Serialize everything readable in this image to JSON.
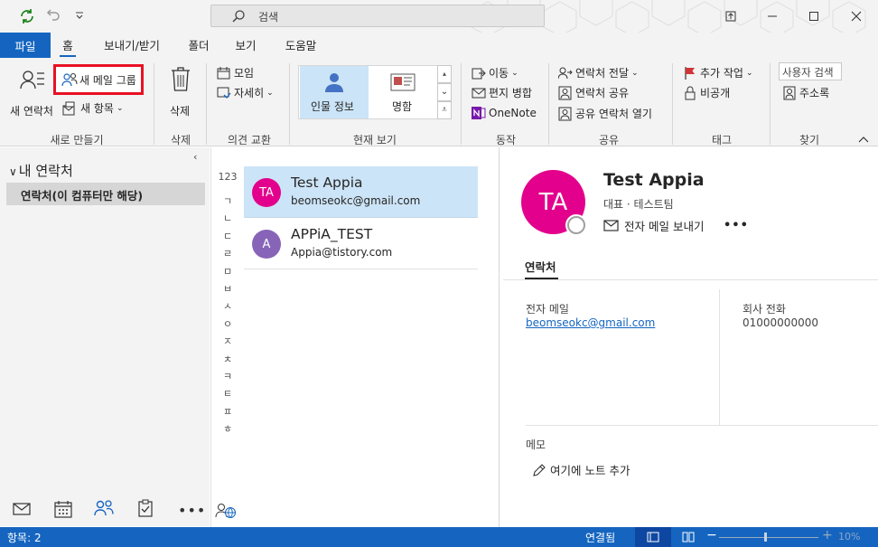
{
  "titlebar": {
    "search_placeholder": "검색",
    "icons": [
      "sync-icon",
      "undo-icon",
      "quick-access-dropdown-icon",
      "search-icon",
      "ribbon-display-options-icon",
      "minimize-icon",
      "maximize-icon",
      "close-icon"
    ]
  },
  "tabs": {
    "file": "파일",
    "home": "홈",
    "send_receive": "보내기/받기",
    "folder": "폴더",
    "view": "보기",
    "help": "도움말"
  },
  "ribbon": {
    "new": {
      "new_contact": "새 연락처",
      "new_contact_group": "새 메일 그룹",
      "new_items": "새 항목",
      "label": "새로 만들기"
    },
    "delete": {
      "button": "삭제",
      "label": "삭제"
    },
    "communicate": {
      "meeting": "모임",
      "more": "자세히",
      "label": "의견 교환"
    },
    "current_view": {
      "people": "인물 정보",
      "business_card": "명함",
      "label": "현재 보기"
    },
    "actions": {
      "move": "이동",
      "mail_merge": "편지 병합",
      "onenote": "OneNote",
      "label": "동작"
    },
    "share": {
      "forward_contact": "연락처 전달",
      "share_contacts": "연락처 공유",
      "open_shared": "공유 연락처 열기",
      "label": "공유"
    },
    "tags": {
      "follow_up": "추가 작업",
      "private": "비공개",
      "label": "태그"
    },
    "find": {
      "search_people": "사용자 검색",
      "address_book": "주소록",
      "label": "찾기"
    }
  },
  "sidebar": {
    "header": "내 연락처",
    "folder": "연락처(이 컴퓨터만 해당)"
  },
  "alphabet": [
    "123",
    "ㄱ",
    "ㄴ",
    "ㄷ",
    "ㄹ",
    "ㅁ",
    "ㅂ",
    "ㅅ",
    "ㅇ",
    "ㅈ",
    "ㅊ",
    "ㅋ",
    "ㅌ",
    "ㅍ",
    "ㅎ"
  ],
  "contacts": [
    {
      "initials": "TA",
      "name": "Test Appia",
      "email": "beomseokc@gmail.com",
      "color": "#e3008c",
      "selected": true
    },
    {
      "initials": "A",
      "name": "APPiA_TEST",
      "email": "Appia@tistory.com",
      "color": "#8764b8",
      "selected": false
    }
  ],
  "detail": {
    "initials": "TA",
    "name": "Test Appia",
    "subtitle": "대표 · 테스트팀",
    "send_email": "전자 메일 보내기",
    "more": "•••",
    "tab": "연락처",
    "email_label": "전자 메일",
    "email_value": "beomseokc@gmail.com",
    "phone_label": "회사 전화",
    "phone_value": "01000000000",
    "memo_label": "메모",
    "memo_add": "여기에 노트 추가"
  },
  "status": {
    "items": "항목: 2",
    "connection": "연결됨",
    "zoom": "10%"
  },
  "colors": {
    "accent": "#1565c0",
    "highlight_box": "#e81123",
    "selected_row": "#cce4f7"
  }
}
